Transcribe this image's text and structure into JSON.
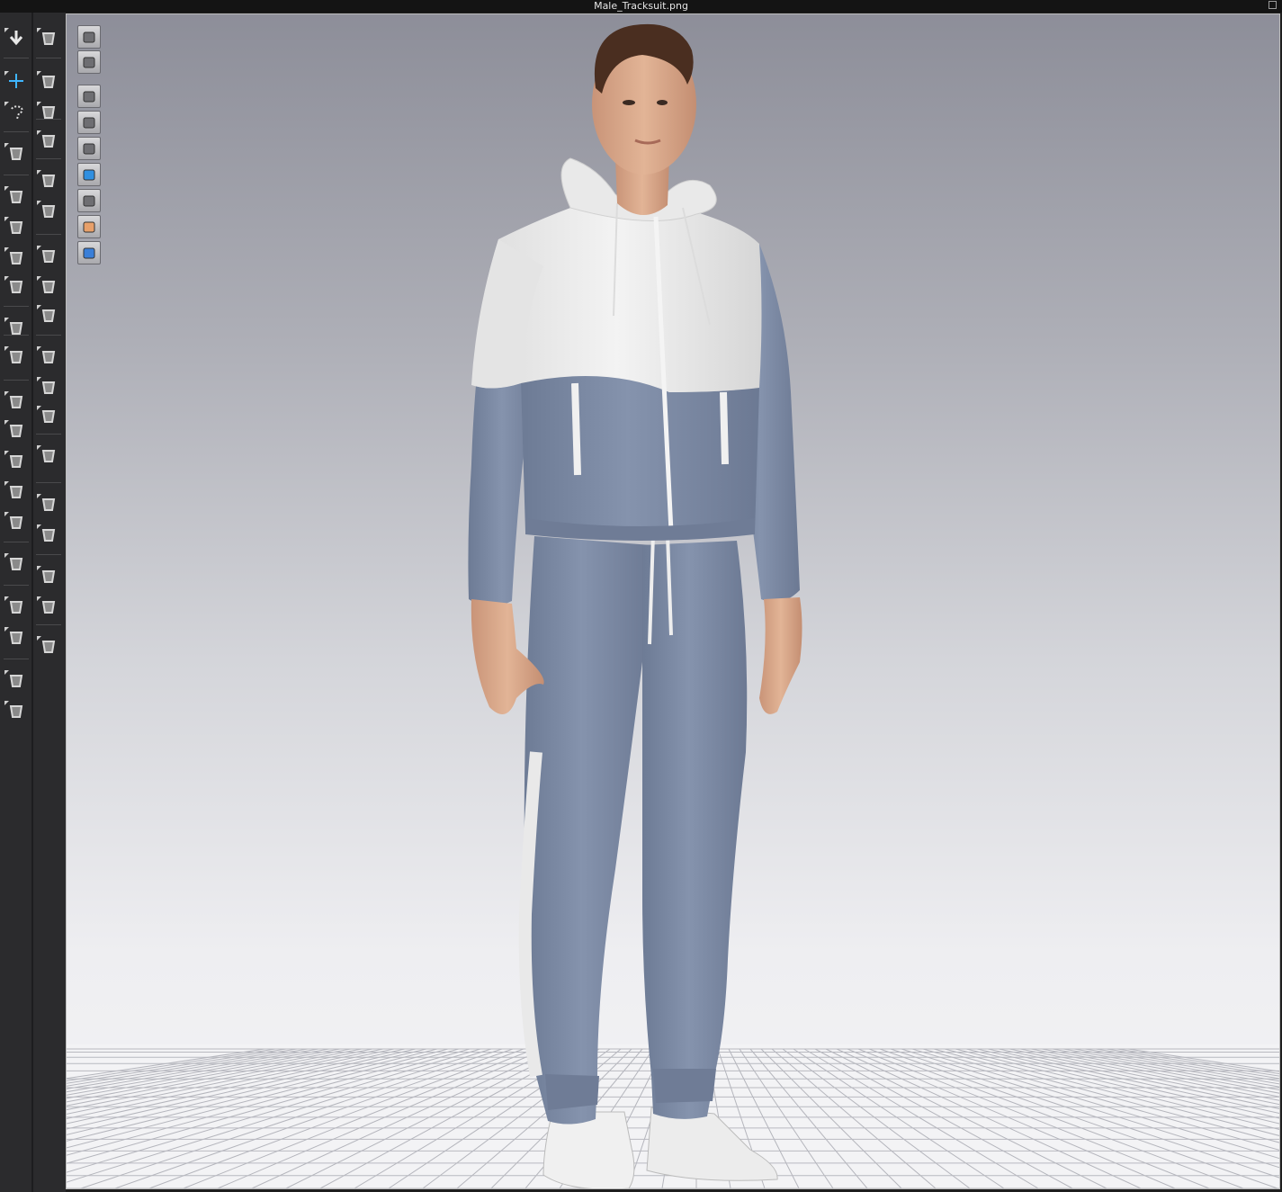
{
  "window": {
    "title": "Male_Tracksuit.png"
  },
  "toolbar": {
    "left_column": [
      {
        "icon": "simulation-arrow-icon"
      },
      {
        "icon": "transform-move-icon",
        "active": true
      },
      {
        "icon": "lasso-select-icon"
      },
      {
        "icon": "garment-icon"
      },
      {
        "icon": "rotate-pattern-icon"
      },
      {
        "icon": "edit-points-icon"
      },
      {
        "icon": "fold-icon"
      },
      {
        "icon": "tape-icon"
      },
      {
        "icon": "needle-pin-icon"
      },
      {
        "icon": "brush-icon"
      },
      {
        "icon": "edit-texture-icon"
      },
      {
        "icon": "fabric-layer-icon"
      },
      {
        "icon": "shirt-arrange-icon"
      },
      {
        "icon": "body-strap-icon"
      },
      {
        "icon": "avatar-measure-icon"
      },
      {
        "icon": "graphic-tool-icon"
      },
      {
        "icon": "ruler-curve-icon"
      },
      {
        "icon": "ruler-straight-icon"
      },
      {
        "icon": "shirt-left-icon"
      },
      {
        "icon": "shirt-right-icon"
      }
    ],
    "right_column": [
      {
        "icon": "walk-pose-icon"
      },
      {
        "icon": "pin-tool-icon"
      },
      {
        "icon": "pin-brush-icon"
      },
      {
        "icon": "edit-pin-icon"
      },
      {
        "icon": "tack-icon"
      },
      {
        "icon": "tack-edit-icon"
      },
      {
        "icon": "measure-garment-icon"
      },
      {
        "icon": "shirt-fit-icon"
      },
      {
        "icon": "checker-shirt-icon"
      },
      {
        "icon": "button-icon"
      },
      {
        "icon": "button-hole-icon"
      },
      {
        "icon": "lock-button-icon"
      },
      {
        "icon": "zipper-icon"
      },
      {
        "icon": "rectangle-fill-icon"
      },
      {
        "icon": "cylinder-icon"
      },
      {
        "icon": "gradient-rect-icon"
      },
      {
        "icon": "square-fill-icon"
      },
      {
        "icon": "align-arrows-icon"
      }
    ]
  },
  "viewport_toolbar": [
    {
      "icon": "view-fabric-icon"
    },
    {
      "icon": "view-shirt-icon"
    },
    {
      "icon": "show-garment-icon"
    },
    {
      "icon": "show-brush-icon"
    },
    {
      "icon": "show-avatar-icon"
    },
    {
      "icon": "show-blue-panel-icon"
    },
    {
      "icon": "show-layer-icon"
    },
    {
      "icon": "show-skin-icon"
    },
    {
      "icon": "show-globe-icon"
    }
  ],
  "colors": {
    "tracksuit_blue": "#7e8ca6",
    "tracksuit_white": "#eeeeee",
    "skin": "#d9a888",
    "hair": "#4a2e20",
    "accent": "#3fb6ff"
  }
}
